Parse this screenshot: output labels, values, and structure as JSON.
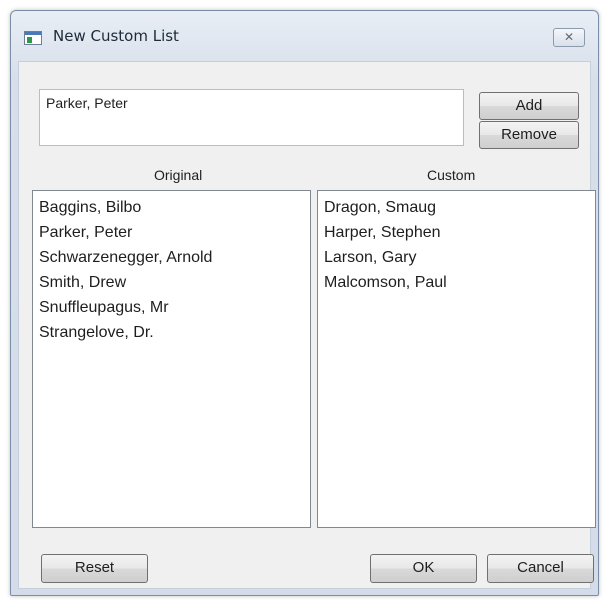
{
  "window": {
    "title": "New Custom List",
    "close_glyph": "✕",
    "app_icon": "window-app-icon"
  },
  "entry": {
    "value": "Parker, Peter"
  },
  "buttons": {
    "add": "Add",
    "remove": "Remove",
    "reset": "Reset",
    "ok": "OK",
    "cancel": "Cancel"
  },
  "original": {
    "label": "Original",
    "items": [
      "Baggins, Bilbo",
      "Parker, Peter",
      "Schwarzenegger, Arnold",
      "Smith, Drew",
      "Snuffleupagus, Mr",
      "Strangelove, Dr."
    ]
  },
  "custom": {
    "label": "Custom",
    "items": [
      "Dragon, Smaug",
      "Harper, Stephen",
      "Larson, Gary",
      "Malcomson, Paul"
    ]
  }
}
